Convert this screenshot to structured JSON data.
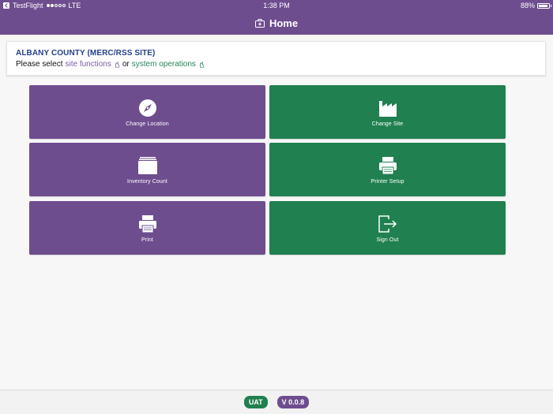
{
  "statusbar": {
    "app": "TestFlight",
    "carrier": "LTE",
    "time": "1:38 PM",
    "battery": "88%"
  },
  "nav": {
    "title": "Home",
    "icon": "briefcase-plus-icon"
  },
  "site": {
    "name": "ALBANY COUNTY (MERC/RSS SITE)",
    "prompt_prefix": "Please select",
    "link_functions": "site functions",
    "joiner": "or",
    "link_operations": "system operations"
  },
  "tiles": [
    {
      "label": "Change Location",
      "icon": "compass-icon",
      "color": "#6e4d8f"
    },
    {
      "label": "Change Site",
      "icon": "factory-icon",
      "color": "#20804f"
    },
    {
      "label": "Inventory Count",
      "icon": "stack-icon",
      "color": "#6e4d8f"
    },
    {
      "label": "Printer Setup",
      "icon": "printer-icon",
      "color": "#20804f"
    },
    {
      "label": "Print",
      "icon": "printer-icon",
      "color": "#6e4d8f"
    },
    {
      "label": "Sign Out",
      "icon": "sign-out-icon",
      "color": "#20804f"
    }
  ],
  "footer": {
    "env_badge": "UAT",
    "version_badge": "V 0.0.8"
  },
  "colors": {
    "purple": "#6e4d8f",
    "green": "#20804f",
    "site_name": "#23418a"
  }
}
